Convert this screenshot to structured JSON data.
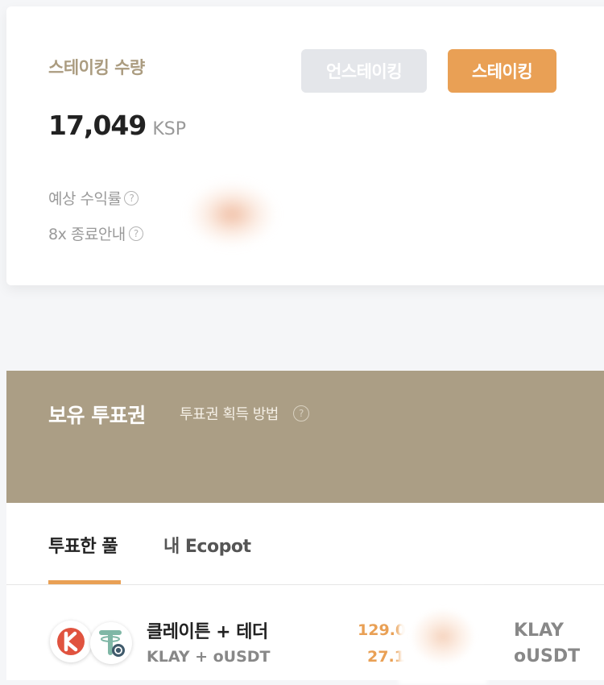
{
  "staking": {
    "title": "스테이킹 수량",
    "unstake_label": "언스테이킹",
    "stake_label": "스테이킹",
    "amount": "17,049",
    "unit": "KSP",
    "expected_return_label": "예상 수익률",
    "end_notice_label": "8x 종료안내",
    "help_icon": "?"
  },
  "votes": {
    "title": "보유 투표권",
    "howto_label": "투표권 획득 방법",
    "help_icon": "?"
  },
  "tabs": {
    "voted_pools": "투표한 풀",
    "my_ecopot": "내 Ecopot"
  },
  "pool": {
    "name": "클레이튼 + 테더",
    "pair": "KLAY + oUSDT",
    "value1": "129.0",
    "value2": "27.1",
    "token1": "KLAY",
    "token2": "oUSDT"
  },
  "colors": {
    "accent": "#e9a055",
    "banner": "#ab9e85",
    "muted_title": "#ab9c80"
  }
}
